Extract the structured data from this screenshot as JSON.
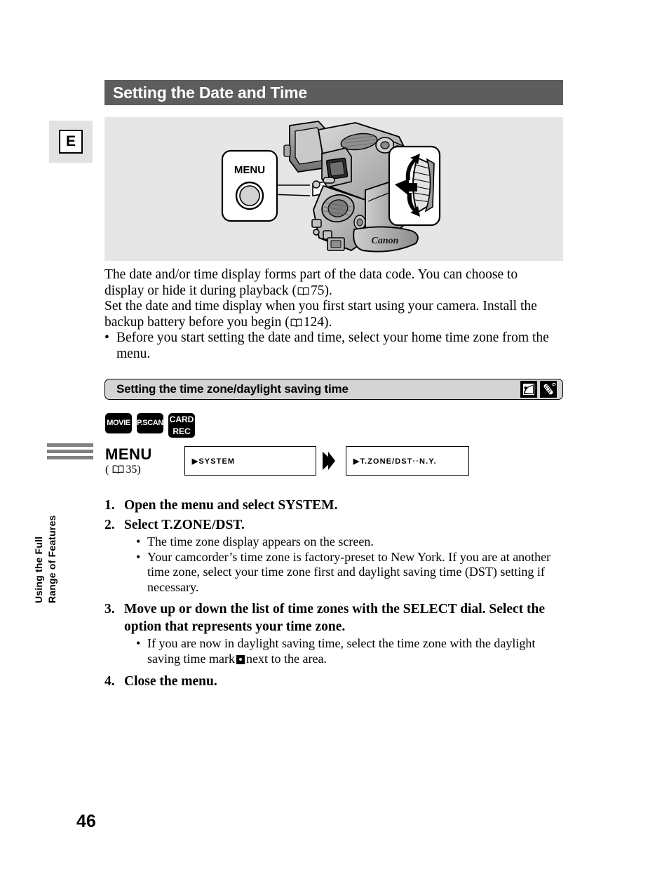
{
  "page": {
    "number": "46",
    "language_tab": "E",
    "chapter_label": "Using the Full\nRange of Features"
  },
  "title_bar": {
    "title": "Setting the Date and Time"
  },
  "illustration": {
    "menu_callout_label": "MENU",
    "brand": "Canon",
    "menu_button_name": "menu-button",
    "dial_name": "select-dial"
  },
  "intro": {
    "line1": "The date and/or time display forms part of the data code. You can choose to",
    "line2_pre": "display or hide it during playback (",
    "line2_ref": "75",
    "line2_post": ").",
    "line3": "Set the date and time display when you first start using your camera. Install the",
    "line4_pre": "backup battery before you begin (",
    "line4_ref": "124",
    "line4_post": ").",
    "bullet_dot": "•",
    "bullet_text": "Before you start setting the date and time, select your home time zone from the menu."
  },
  "subsection": {
    "label": "Setting the time zone/daylight saving time",
    "icons": [
      "camera-lcd-icon",
      "remote-control-icon"
    ]
  },
  "mode_badges": [
    {
      "name": "movie-mode-badge",
      "line1": "MOVIE",
      "line2": ""
    },
    {
      "name": "pscan-mode-badge",
      "line1": "P.SCAN",
      "line2": ""
    },
    {
      "name": "card-rec-mode-badge",
      "line1": "CARD",
      "line2": "REC"
    }
  ],
  "menu_flow": {
    "menu_word": "MENU",
    "menu_ref_open": "( ",
    "menu_ref_page": "35",
    "menu_ref_close": ")",
    "box1": "▶SYSTEM",
    "box2": "▶T.ZONE/DST··N.Y."
  },
  "steps": [
    {
      "num": "1.",
      "heading": "Open the menu and select SYSTEM.",
      "bullets": []
    },
    {
      "num": "2.",
      "heading": "Select T.ZONE/DST.",
      "bullets": [
        "The time zone display appears on the screen.",
        "Your camcorder’s time zone is factory-preset to New York. If you are at another time zone, select your time zone first and daylight saving time (DST) setting if necessary."
      ]
    },
    {
      "num": "3.",
      "heading": "Move up or down the list of time zones with the SELECT dial. Select the option that represents your time zone.",
      "bullets": [],
      "bullet_dst_pre": "If you are now in daylight saving time, select the time zone with the daylight saving time mark",
      "bullet_dst_post": "next to the area."
    },
    {
      "num": "4.",
      "heading": "Close the menu.",
      "bullets": []
    }
  ],
  "bullet_dot": "•",
  "colors": {
    "title_bar_bg": "#5d5d5d",
    "illustration_bg": "#e6e6e6",
    "subsection_bg": "#d4d4d4",
    "rule_gray": "#808080"
  }
}
